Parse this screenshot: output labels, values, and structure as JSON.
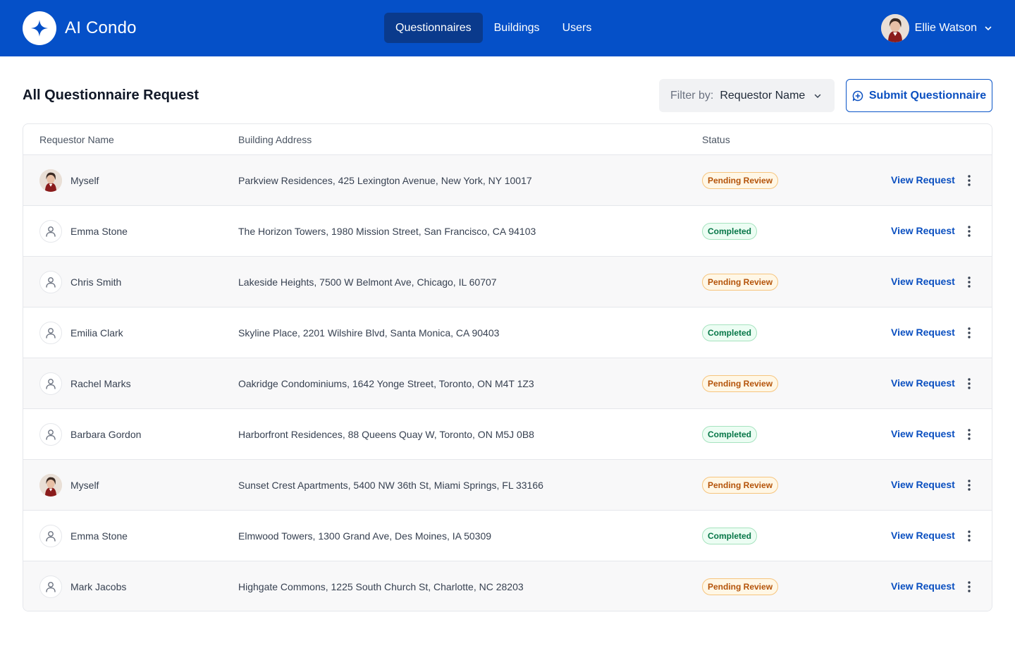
{
  "app": {
    "name": "AI Condo",
    "brand_color": "#0550c8"
  },
  "nav": {
    "items": [
      {
        "label": "Questionnaires",
        "active": true
      },
      {
        "label": "Buildings",
        "active": false
      },
      {
        "label": "Users",
        "active": false
      }
    ]
  },
  "user": {
    "name": "Ellie Watson",
    "menu_icon": "chevron-down-icon"
  },
  "page": {
    "title": "All Questionnaire Request"
  },
  "filter": {
    "label": "Filter by:",
    "value": "Requestor Name",
    "icon": "chevron-down-icon"
  },
  "submit_button": {
    "label": "Submit Questionnaire",
    "icon": "chat-plus-icon"
  },
  "table": {
    "columns": [
      "Requestor Name",
      "Building Address",
      "Status"
    ],
    "rows": [
      {
        "requestor": "Myself",
        "avatar": "photo",
        "address": "Parkview Residences, 425 Lexington Avenue, New York, NY 10017",
        "status": "Pending Review",
        "action": "View Request"
      },
      {
        "requestor": "Emma Stone",
        "avatar": "generic",
        "address": "The Horizon Towers, 1980 Mission Street, San Francisco, CA 94103",
        "status": "Completed",
        "action": "View Request"
      },
      {
        "requestor": "Chris Smith",
        "avatar": "generic",
        "address": "Lakeside Heights, 7500 W Belmont Ave, Chicago, IL 60707",
        "status": "Pending Review",
        "action": "View Request"
      },
      {
        "requestor": "Emilia Clark",
        "avatar": "generic",
        "address": "Skyline Place, 2201 Wilshire Blvd, Santa Monica, CA 90403",
        "status": "Completed",
        "action": "View Request"
      },
      {
        "requestor": "Rachel Marks",
        "avatar": "generic",
        "address": "Oakridge Condominiums, 1642 Yonge Street, Toronto, ON M4T 1Z3",
        "status": "Pending Review",
        "action": "View Request"
      },
      {
        "requestor": "Barbara Gordon",
        "avatar": "generic",
        "address": "Harborfront Residences, 88 Queens Quay W, Toronto, ON M5J 0B8",
        "status": "Completed",
        "action": "View Request"
      },
      {
        "requestor": "Myself",
        "avatar": "photo",
        "address": "Sunset Crest Apartments, 5400 NW 36th St, Miami Springs, FL 33166",
        "status": "Pending Review",
        "action": "View Request"
      },
      {
        "requestor": "Emma Stone",
        "avatar": "generic",
        "address": "Elmwood Towers, 1300 Grand Ave, Des Moines, IA 50309",
        "status": "Completed",
        "action": "View Request"
      },
      {
        "requestor": "Mark Jacobs",
        "avatar": "generic",
        "address": "Highgate Commons, 1225 South Church St, Charlotte, NC 28203",
        "status": "Pending Review",
        "action": "View Request"
      }
    ]
  },
  "colors": {
    "pending": "#b45309",
    "completed": "#067647",
    "link": "#0a4fc0"
  }
}
